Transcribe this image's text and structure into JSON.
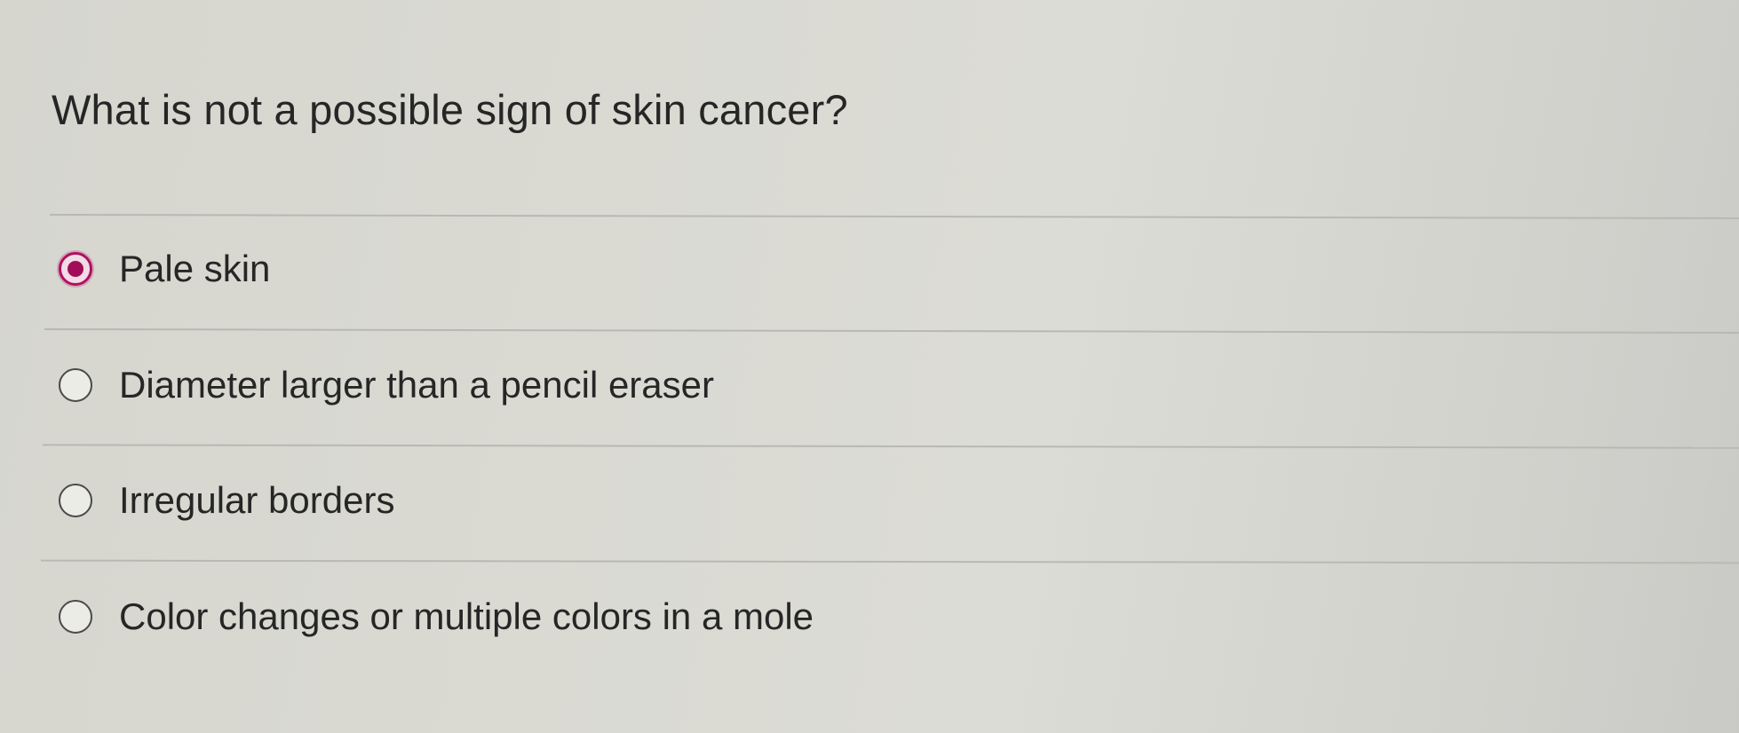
{
  "question": {
    "text": "What is not a possible sign of skin cancer?"
  },
  "options": [
    {
      "label": "Pale skin",
      "selected": true
    },
    {
      "label": "Diameter larger than a pencil eraser",
      "selected": false
    },
    {
      "label": "Irregular borders",
      "selected": false
    },
    {
      "label": "Color changes or multiple colors in a mole",
      "selected": false
    }
  ],
  "colors": {
    "selected_accent": "#b0115f",
    "text": "#262626",
    "divider": "#b9b9b3"
  },
  "icons": {
    "selected": "radio-selected-icon",
    "unselected": "radio-unselected-icon"
  }
}
